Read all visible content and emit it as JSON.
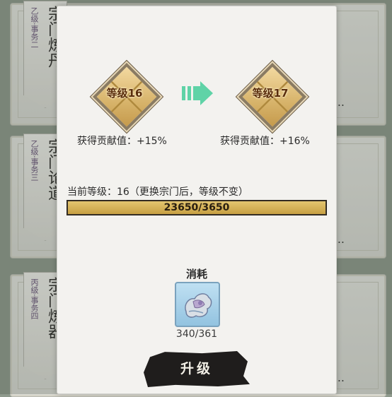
{
  "background_tasks": [
    {
      "grade": "乙级·事务二",
      "name": "宗门炼丹"
    },
    {
      "grade": "乙级·事务三",
      "name": "宗门论道"
    },
    {
      "grade": "丙级·事务四",
      "name": "宗门炼器"
    }
  ],
  "background_ellipsis": "...",
  "modal": {
    "current_level_badge": "等级16",
    "next_level_badge": "等级17",
    "current_contribution": "获得贡献值：+15%",
    "next_contribution": "获得贡献值：+16%",
    "level_info": "当前等级：16（更换宗门后，等级不变）",
    "progress": {
      "text": "23650/3650",
      "fill_fraction": 1.0
    },
    "consume_title": "消耗",
    "item_icon": "jade-scroll-icon",
    "item_count": "340/361",
    "upgrade_label": "升级"
  },
  "colors": {
    "bar_fill": "#d4b055",
    "badge_gold": "#d7b36a",
    "arrow_green": "#5fd3a7",
    "button_dark": "#1f1d1c"
  }
}
